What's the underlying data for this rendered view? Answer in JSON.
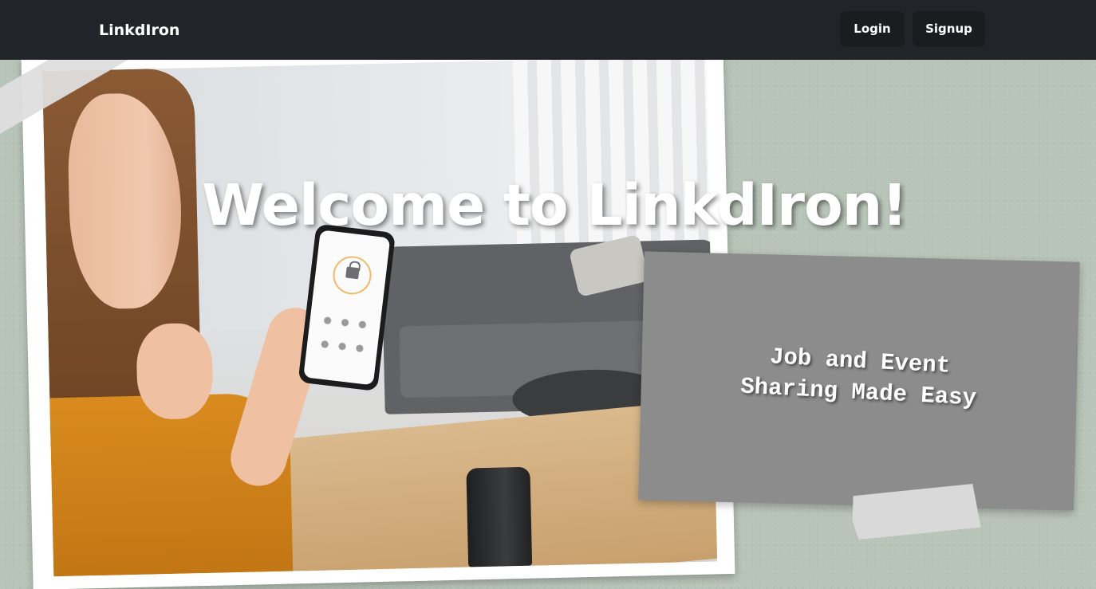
{
  "navbar": {
    "brand": "LinkdIron",
    "login_label": "Login",
    "signup_label": "Signup"
  },
  "hero": {
    "headline": "Welcome to LinkdIron!",
    "tagline_line1": "Job and Event",
    "tagline_line2": "Sharing Made Easy"
  },
  "colors": {
    "navbar_bg": "#212529",
    "page_bg": "#b8c4b8",
    "note_card_bg": "#8c8c8c",
    "button_bg": "#1a1d20"
  }
}
